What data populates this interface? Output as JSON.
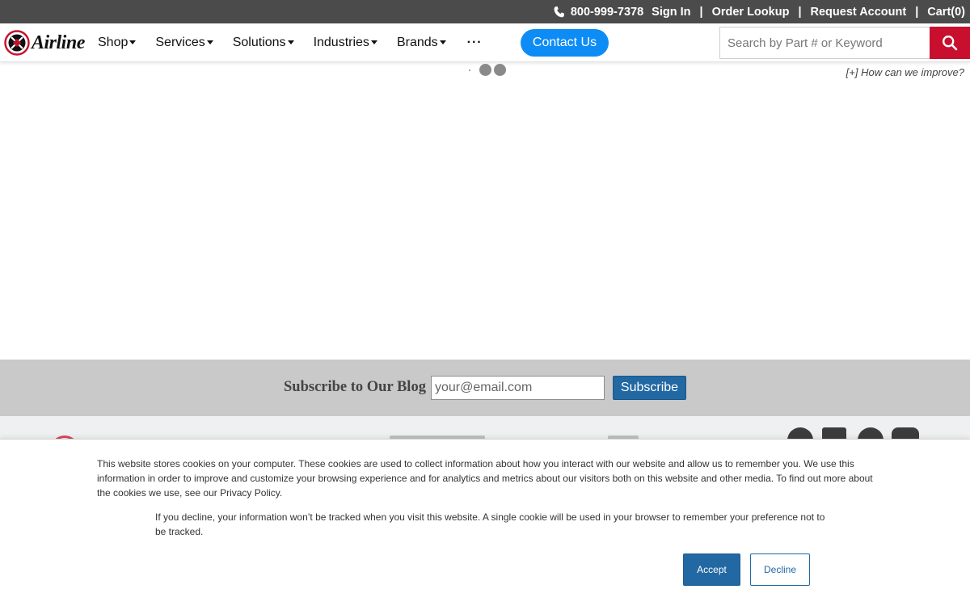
{
  "topbar": {
    "phone_icon": "phone-icon",
    "phone": "800-999-7378",
    "sign_in": "Sign In",
    "separator": "|",
    "order_lookup": "Order Lookup",
    "request_account": "Request Account",
    "cart": "Cart(0)"
  },
  "logo": {
    "text": "Airline"
  },
  "nav": {
    "items": [
      {
        "label": "Shop"
      },
      {
        "label": "Services"
      },
      {
        "label": "Solutions"
      },
      {
        "label": "Industries"
      },
      {
        "label": "Brands"
      }
    ],
    "more_label": "···",
    "contact_label": "Contact Us"
  },
  "search": {
    "placeholder": "Search by Part # or Keyword",
    "button_icon": "search-icon"
  },
  "feedback": {
    "label": "[+] How can we improve?"
  },
  "subscribe": {
    "title": "Subscribe to Our Blog",
    "placeholder": "your@email.com",
    "button": "Subscribe"
  },
  "cookie": {
    "text1": "This website stores cookies on your computer. These cookies are used to collect information about how you interact with our website and allow us to remember you. We use this information in order to improve and customize your browsing experience and for analytics and metrics about our visitors both on this website and other media. To find out more about the cookies we use, see our Privacy Policy.",
    "text2": "If you decline, your information won’t be tracked when you visit this website. A single cookie will be used in your browser to remember your preference not to be tracked.",
    "accept": "Accept",
    "decline": "Decline"
  },
  "colors": {
    "topbar_bg": "#4b4b4b",
    "contact_blue": "#0d8cf5",
    "search_red": "#c8102e",
    "button_blue": "#2268a3",
    "subscribe_bg": "#c9c9c9"
  }
}
